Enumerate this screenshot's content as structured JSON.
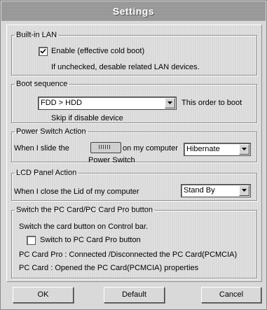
{
  "window": {
    "title": "Settings"
  },
  "lan": {
    "legend": "Built-in LAN",
    "enable_label": "Enable (effective cold boot)",
    "enable_checked": true,
    "note": "If unchecked, desable related LAN devices."
  },
  "boot": {
    "legend": "Boot sequence",
    "selected": "FDD > HDD",
    "hint": "This order to boot",
    "skip_note": "Skip if disable device"
  },
  "power": {
    "legend": "Power Switch Action",
    "prefix": "When I slide the",
    "suffix": "on my computer",
    "slider_caption": "Power Switch",
    "selected": "Hibernate"
  },
  "lcd": {
    "legend": "LCD Panel Action",
    "label": "When I close the Lid of my computer",
    "selected": "Stand By"
  },
  "pccard": {
    "legend": "Switch the PC Card/PC Card Pro button",
    "desc": "Switch the card button on Control bar.",
    "checkbox_label": "Switch to PC Card Pro button",
    "checkbox_checked": false,
    "line1": "PC Card Pro : Connected /Disconnected the PC Card(PCMCIA)",
    "line2": "PC Card : Opened the PC Card(PCMCIA) properties"
  },
  "buttons": {
    "ok": "OK",
    "default": "Default",
    "cancel": "Cancel"
  }
}
